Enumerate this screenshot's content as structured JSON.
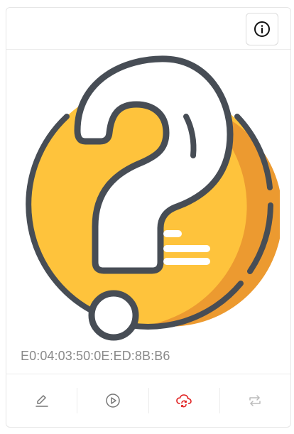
{
  "device": {
    "identifier": "E0:04:03:50:0E:ED:8B:B6"
  },
  "header": {
    "info_icon": "info-circle-icon"
  },
  "illustration": {
    "icon": "question-mark-icon",
    "colors": {
      "circle_fill": "#FEC33C",
      "circle_shadow": "#EC9A30",
      "outline": "#474D55",
      "mark_fill": "#FFFFFF"
    }
  },
  "footer": {
    "actions": [
      {
        "icon": "edit-icon",
        "color": "#777777"
      },
      {
        "icon": "play-icon",
        "color": "#777777"
      },
      {
        "icon": "cloud-sync-icon",
        "color": "#E02020"
      },
      {
        "icon": "repeat-icon",
        "color": "#BBBBBB"
      }
    ]
  }
}
